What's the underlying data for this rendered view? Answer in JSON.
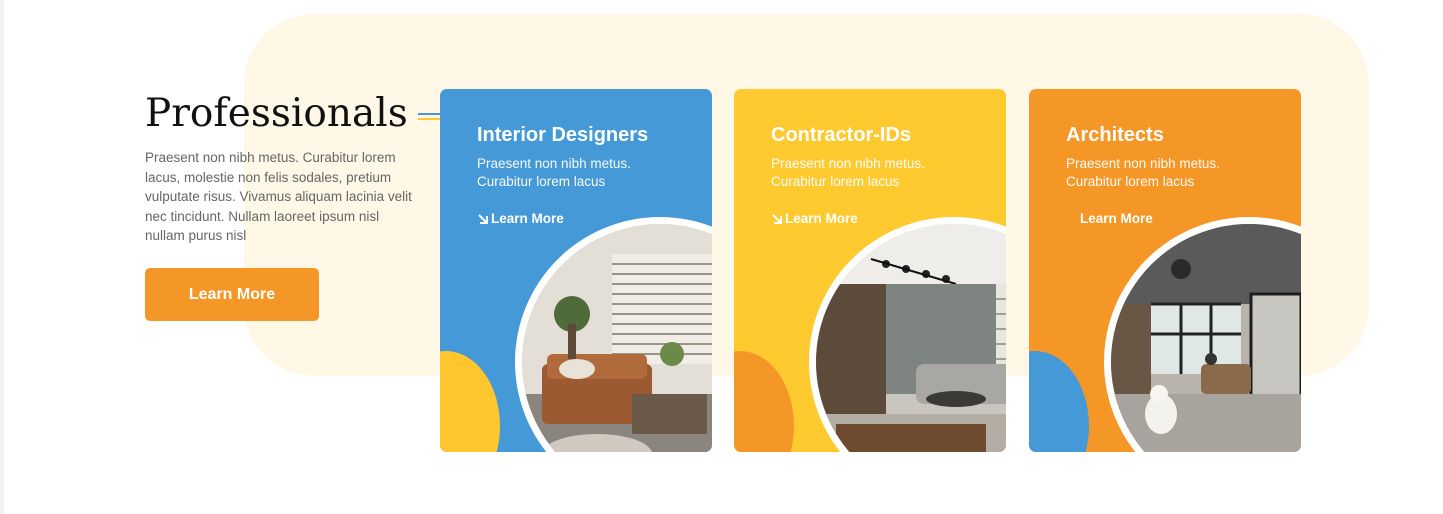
{
  "intro": {
    "title": "Professionals",
    "description": "Praesent non nibh metus. Curabitur lorem lacus, molestie non felis sodales, pretium vulputate risus. Vivamus aliquam lacinia velit nec tincidunt. Nullam laoreet ipsum nisl nullam purus nisl",
    "button_label": "Learn More"
  },
  "cards": [
    {
      "title": "Interior Designers",
      "description": "Praesent non nibh metus. Curabitur lorem lacus",
      "link_label": "Learn More",
      "link_icon": "arrow-down-right-icon",
      "color": "#4499d6",
      "accent_color": "#ffc630"
    },
    {
      "title": "Contractor-IDs",
      "description": "Praesent non nibh metus. Curabitur lorem lacus",
      "link_label": "Learn More",
      "link_icon": "arrow-down-right-icon",
      "color": "#ffc930",
      "accent_color": "#f59727"
    },
    {
      "title": "Architects",
      "description": "Praesent non nibh metus. Curabitur lorem lacus",
      "link_label": "Learn More",
      "link_icon": "",
      "color": "#f59727",
      "accent_color": "#4499d6"
    }
  ],
  "colors": {
    "blue": "#4499d6",
    "yellow": "#ffc930",
    "orange": "#f59727",
    "panel": "#fff8e6"
  }
}
